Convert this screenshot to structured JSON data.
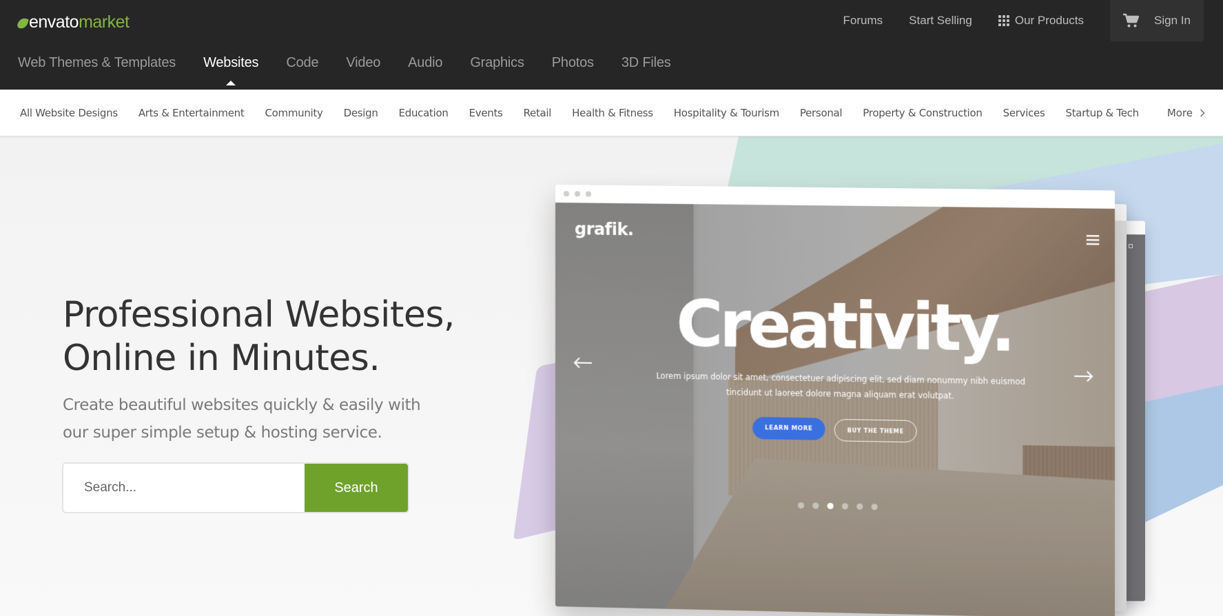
{
  "header": {
    "logo": {
      "primary": "envato",
      "secondary": "market"
    },
    "utility_links": [
      {
        "label": "Forums"
      },
      {
        "label": "Start Selling"
      },
      {
        "label": "Our Products",
        "icon": "grid-icon"
      }
    ],
    "sign_in": {
      "label": "Sign In",
      "icon": "cart-icon"
    },
    "main_nav": [
      {
        "label": "Web Themes & Templates",
        "active": false
      },
      {
        "label": "Websites",
        "active": true
      },
      {
        "label": "Code",
        "active": false
      },
      {
        "label": "Video",
        "active": false
      },
      {
        "label": "Audio",
        "active": false
      },
      {
        "label": "Graphics",
        "active": false
      },
      {
        "label": "Photos",
        "active": false
      },
      {
        "label": "3D Files",
        "active": false
      }
    ]
  },
  "subnav": {
    "items": [
      {
        "label": "All Website Designs"
      },
      {
        "label": "Arts & Entertainment"
      },
      {
        "label": "Community"
      },
      {
        "label": "Design"
      },
      {
        "label": "Education"
      },
      {
        "label": "Events"
      },
      {
        "label": "Retail"
      },
      {
        "label": "Health & Fitness"
      },
      {
        "label": "Hospitality & Tourism"
      },
      {
        "label": "Personal"
      },
      {
        "label": "Property & Construction"
      },
      {
        "label": "Services"
      },
      {
        "label": "Startup & Tech"
      }
    ],
    "more_label": "More"
  },
  "hero": {
    "title_line1": "Professional Websites,",
    "title_line2": "Online in Minutes.",
    "subtitle_line1": "Create beautiful websites quickly & easily with",
    "subtitle_line2": "our super simple setup & hosting service.",
    "search": {
      "placeholder": "Search...",
      "value": "",
      "button_label": "Search"
    }
  },
  "mockup": {
    "site_logo": "grafik.",
    "headline": "Creativity.",
    "body_line1": "Lorem ipsum dolor sit amet, consectetuer adipiscing elit, sed diam nonummy nibh euismod",
    "body_line2": "tincidunt ut laoreet dolore magna aliquam erat volutpat.",
    "primary_button": "LEARN MORE",
    "secondary_button": "BUY THE THEME",
    "slide_count": 6,
    "active_slide": 3
  },
  "colors": {
    "header_bg": "#262626",
    "brand_green": "#82b541",
    "search_button": "#6fa22b",
    "mockup_primary_button": "#3a6fe0",
    "shape_mint": "#c7e4dc",
    "shape_blue": "#c5d8ee",
    "shape_lilac": "#d8c8e4",
    "shape_blue_dark": "#adc8e6"
  }
}
